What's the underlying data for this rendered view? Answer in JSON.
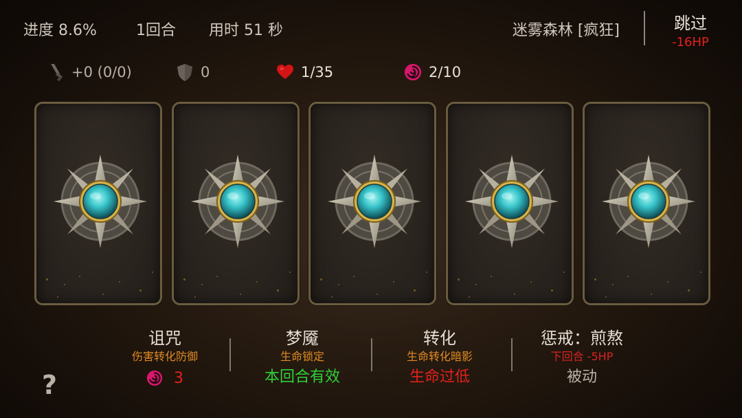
{
  "header": {
    "progress": "进度 8.6%",
    "round": "1回合",
    "time": "用时 51 秒",
    "location": "迷雾森林 [疯狂]",
    "skip_label": "跳过",
    "skip_cost": "-16HP"
  },
  "resources": {
    "attack": "+0 (0/0)",
    "defense": "0",
    "health": "1/35",
    "corruption": "2/10"
  },
  "cards": [
    {
      "state": "face-down"
    },
    {
      "state": "face-down"
    },
    {
      "state": "face-down"
    },
    {
      "state": "face-down"
    },
    {
      "state": "face-down"
    }
  ],
  "effects": {
    "curse": {
      "title": "诅咒",
      "desc": "伤害转化防御",
      "count": "3"
    },
    "nightmare": {
      "title": "梦魇",
      "desc": "生命锁定",
      "status": "本回合有效"
    },
    "transform": {
      "title": "转化",
      "desc": "生命转化暗影",
      "status": "生命过低"
    },
    "punish": {
      "title": "惩戒：煎熬",
      "desc": "下回合 -5HP",
      "status": "被动"
    }
  },
  "help_label": "?",
  "colors": {
    "cost_red": "#e3211d",
    "desc_orange": "#e08b22",
    "status_green": "#2ed13a",
    "card_border": "#6b5c40",
    "gem_cyan": "#37c4c9"
  }
}
